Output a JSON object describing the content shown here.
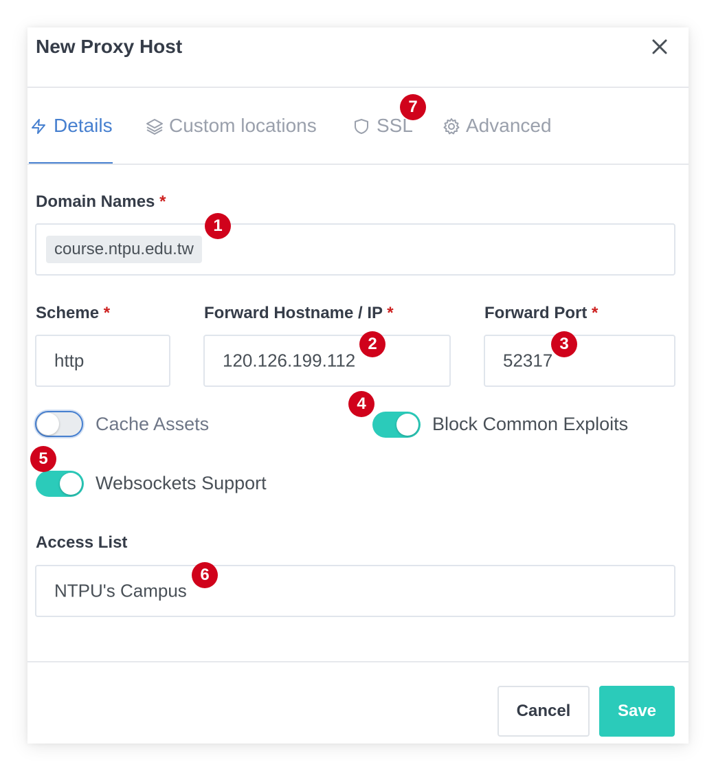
{
  "modal": {
    "title": "New Proxy Host"
  },
  "tabs": [
    {
      "label": "Details",
      "icon": "lightning-icon",
      "active": true
    },
    {
      "label": "Custom locations",
      "icon": "layers-icon",
      "active": false
    },
    {
      "label": "SSL",
      "icon": "shield-icon",
      "active": false
    },
    {
      "label": "Advanced",
      "icon": "gear-icon",
      "active": false
    }
  ],
  "form": {
    "domain_names": {
      "label": "Domain Names",
      "required_mark": "*",
      "chips": [
        "course.ntpu.edu.tw"
      ]
    },
    "scheme": {
      "label": "Scheme",
      "required_mark": "*",
      "value": "http"
    },
    "forward_host": {
      "label": "Forward Hostname / IP",
      "required_mark": "*",
      "value": "120.126.199.112"
    },
    "forward_port": {
      "label": "Forward Port",
      "required_mark": "*",
      "value": "52317"
    },
    "toggles": {
      "cache_assets": {
        "label": "Cache Assets",
        "on": false
      },
      "block_common_exploits": {
        "label": "Block Common Exploits",
        "on": true
      },
      "websockets_support": {
        "label": "Websockets Support",
        "on": true
      }
    },
    "access_list": {
      "label": "Access List",
      "value": "NTPU's Campus"
    }
  },
  "badges": [
    "1",
    "2",
    "3",
    "4",
    "5",
    "6",
    "7"
  ],
  "footer": {
    "cancel_label": "Cancel",
    "save_label": "Save"
  },
  "colors": {
    "accent": "#467fcf",
    "toggle_on": "#2bcbba",
    "save_button": "#2bcbba",
    "badge": "#d0021b",
    "required": "#cd201f"
  }
}
